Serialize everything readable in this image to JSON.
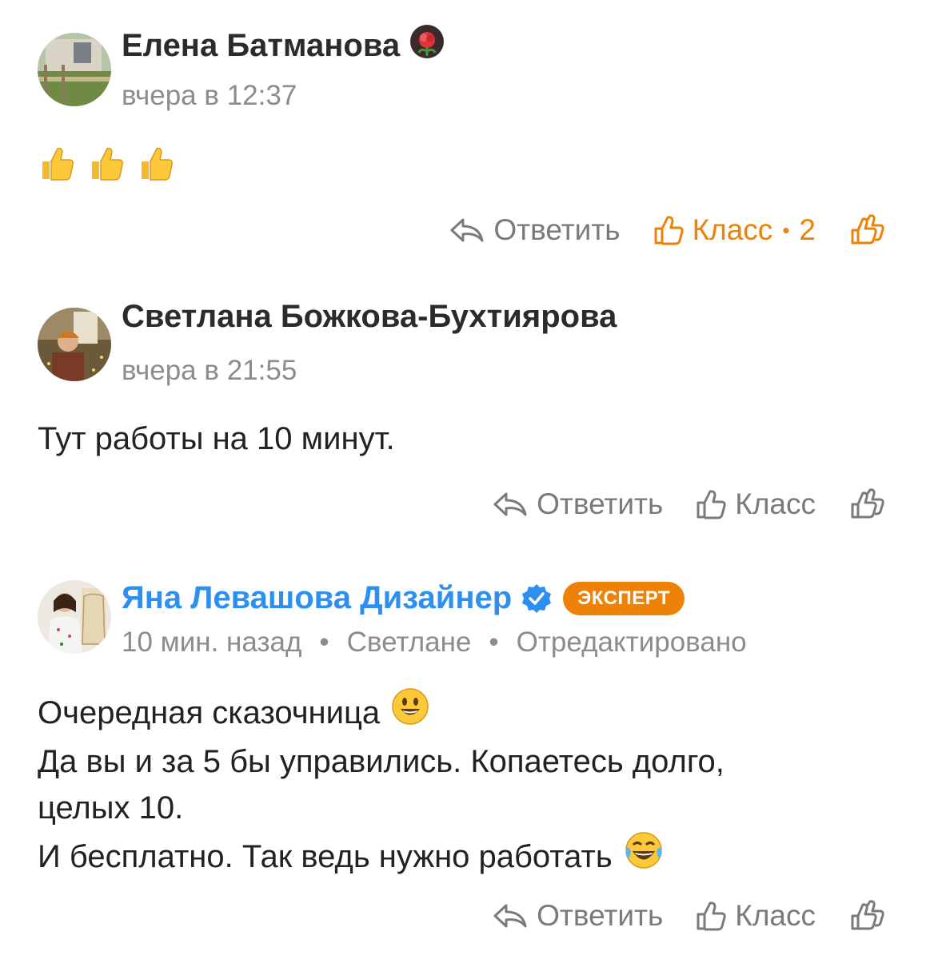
{
  "comments": [
    {
      "author": "Елена Батманова",
      "time": "вчера в 12:37",
      "text_lines": [],
      "actions": {
        "reply": "Ответить",
        "klass": "Класс",
        "klass_count": "2",
        "klass_active": true
      }
    },
    {
      "author": "Светлана Божкова-Бухтиярова",
      "time": "вчера в 21:55",
      "text_lines": [
        "Тут работы на 10 минут."
      ],
      "actions": {
        "reply": "Ответить",
        "klass": "Класс",
        "klass_active": false
      }
    },
    {
      "author": "Яна Левашова Дизайнер",
      "badge": "ЭКСПЕРТ",
      "time": "10 мин. назад",
      "reply_to": "Светлане",
      "edited": "Отредактировано",
      "text_lines": [
        "Очередная сказочница",
        "Да вы и за 5 бы управились. Копаетесь долго,",
        "целых 10.",
        "И бесплатно. Так ведь нужно работать"
      ],
      "actions": {
        "reply": "Ответить",
        "klass": "Класс",
        "klass_active": false
      }
    }
  ],
  "colors": {
    "accent": "#ee8208",
    "link": "#2d8ff0",
    "muted": "#8c8c8c"
  },
  "icons": [
    "reply-arrow-icon",
    "thumbs-up-outline-icon",
    "double-thumbs-up-icon",
    "verified-check-icon",
    "rose-emoji",
    "thumbs-up-emoji",
    "smile-emoji",
    "laughing-emoji"
  ]
}
